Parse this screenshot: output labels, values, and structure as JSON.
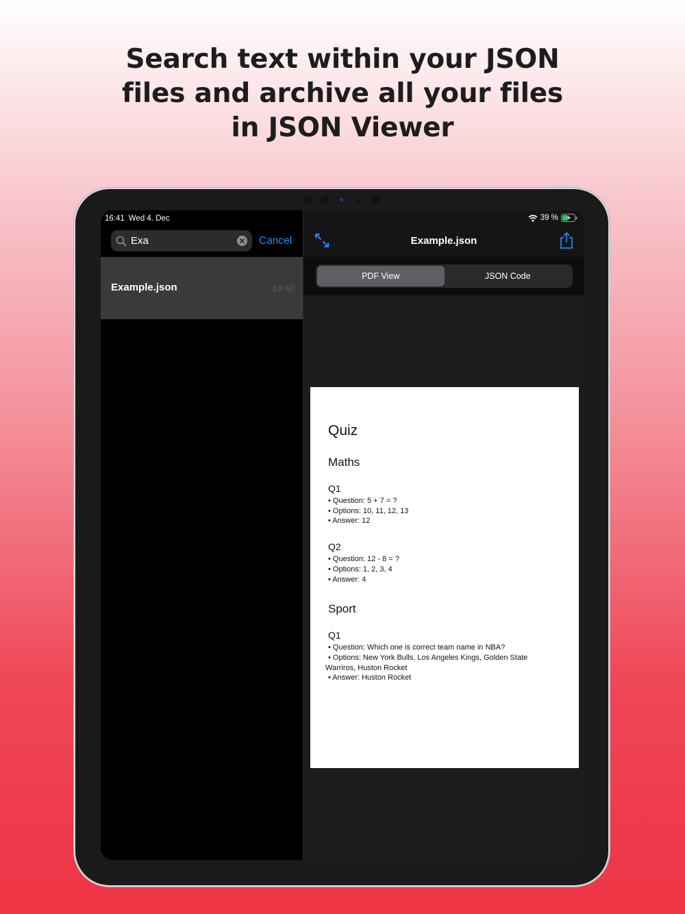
{
  "headline": [
    "Search text within your JSON",
    "files and archive all your files",
    "in JSON Viewer"
  ],
  "status": {
    "time": "16:41",
    "date": "Wed 4. Dec",
    "battery": "39 %"
  },
  "search": {
    "value": "Exa",
    "cancel_label": "Cancel"
  },
  "file_list": [
    {
      "name": "Example.json",
      "time": "16:40"
    }
  ],
  "viewer": {
    "title": "Example.json",
    "tabs": [
      "PDF View",
      "JSON Code"
    ],
    "active_tab": 0
  },
  "document": {
    "title": "Quiz",
    "sections": [
      {
        "name": "Maths",
        "questions": [
          {
            "label": "Q1",
            "lines": [
              "• Question: 5 + 7 = ?",
              "• Options: 10, 11, 12, 13",
              "• Answer: 12"
            ]
          },
          {
            "label": "Q2",
            "lines": [
              "• Question: 12 - 8 = ?",
              "• Options: 1, 2, 3, 4",
              "• Answer: 4"
            ]
          }
        ]
      },
      {
        "name": "Sport",
        "questions": [
          {
            "label": "Q1",
            "lines": [
              "• Question: Which one is correct team name in NBA?",
              "• Options: New York Bulls, Los Angeles Kings, Golden State",
              "Warriros, Huston Rocket",
              "• Answer: Huston Rocket"
            ]
          }
        ]
      }
    ]
  },
  "colors": {
    "accent": "#1e8bff",
    "background_bottom": "#ee3445"
  },
  "icons": [
    "search-icon",
    "clear-icon",
    "wifi-icon",
    "battery-icon",
    "expand-icon",
    "share-icon"
  ]
}
